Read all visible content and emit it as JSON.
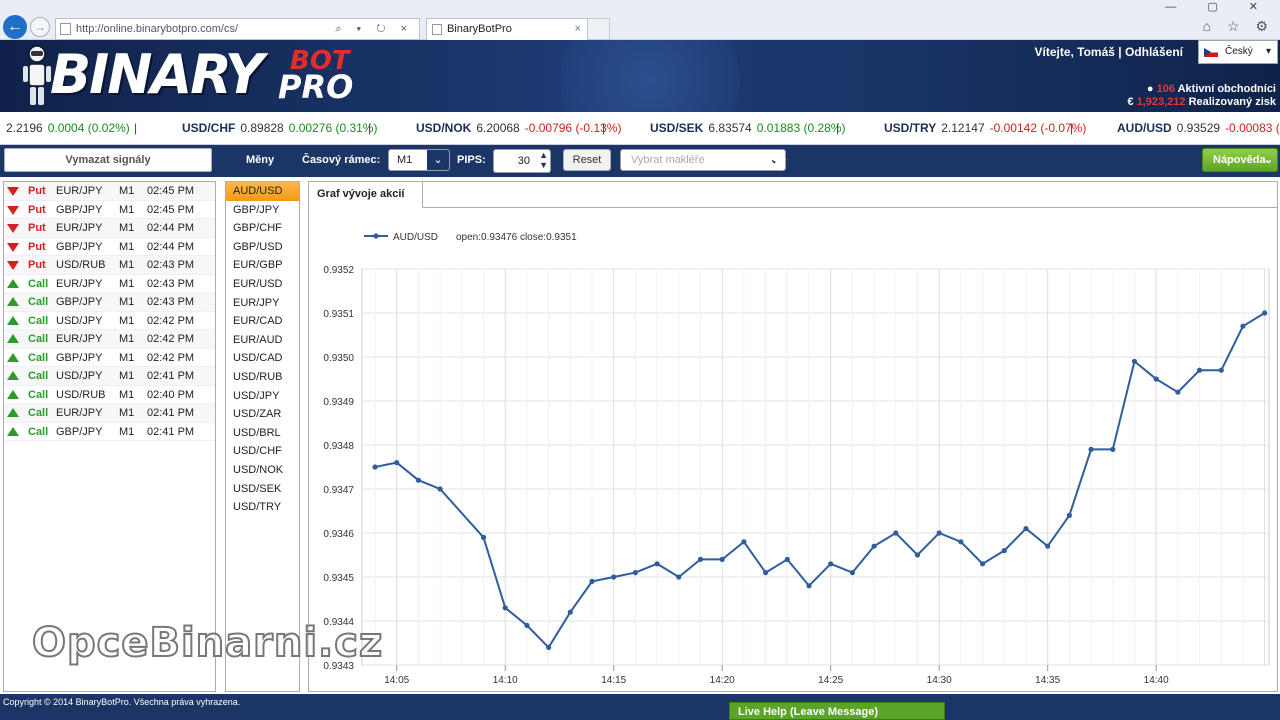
{
  "browser": {
    "url": "http://online.binarybotpro.com/cs/",
    "tab_title": "BinaryBotPro",
    "tab_close": "×",
    "address_tools": "⌕ ▾ ↻ ×",
    "win_controls": "— ▢ ✕",
    "icons": "⌂ ☆ ⚙"
  },
  "header": {
    "logo_text": "BINARY",
    "logo_bot": "BOT",
    "logo_pro": "PRO",
    "welcome": "Vítejte, Tomáš | Odhlášení",
    "language": "Český",
    "active_traders_count": "106",
    "active_traders_label": "Aktivní obchodníci",
    "realized_profit_value": "1,923,212",
    "realized_profit_label": "Realizovaný zisk",
    "currency_symbol": "€"
  },
  "ticker": [
    {
      "sym": "",
      "price": "2.2196",
      "change": "0.0004 (0.02%)",
      "dir": "up"
    },
    {
      "sym": "USD/CHF",
      "price": "0.89828",
      "change": "0.00276 (0.31%)",
      "dir": "up"
    },
    {
      "sym": "USD/NOK",
      "price": "6.20068",
      "change": "-0.00796 (-0.13%)",
      "dir": "down"
    },
    {
      "sym": "USD/SEK",
      "price": "6.83574",
      "change": "0.01883 (0.28%)",
      "dir": "up"
    },
    {
      "sym": "USD/TRY",
      "price": "2.12147",
      "change": "-0.00142 (-0.07%)",
      "dir": "down"
    },
    {
      "sym": "AUD/USD",
      "price": "0.93529",
      "change": "-0.00083 (-0.09%)",
      "dir": "down"
    }
  ],
  "toolbar": {
    "clear_label": "Vymazat signály",
    "currencies_label": "Měny",
    "timeframe_label": "Časový rámec:",
    "timeframe_value": "M1",
    "pips_label": "PIPS:",
    "pips_value": "30",
    "reset_label": "Reset",
    "broker_placeholder": "Vybrat makléře",
    "help_label": "Nápověda"
  },
  "signals": [
    {
      "type": "Put",
      "pair": "EUR/JPY",
      "tf": "M1",
      "time": "02:45 PM"
    },
    {
      "type": "Put",
      "pair": "GBP/JPY",
      "tf": "M1",
      "time": "02:45 PM"
    },
    {
      "type": "Put",
      "pair": "EUR/JPY",
      "tf": "M1",
      "time": "02:44 PM"
    },
    {
      "type": "Put",
      "pair": "GBP/JPY",
      "tf": "M1",
      "time": "02:44 PM"
    },
    {
      "type": "Put",
      "pair": "USD/RUB",
      "tf": "M1",
      "time": "02:43 PM"
    },
    {
      "type": "Call",
      "pair": "EUR/JPY",
      "tf": "M1",
      "time": "02:43 PM"
    },
    {
      "type": "Call",
      "pair": "GBP/JPY",
      "tf": "M1",
      "time": "02:43 PM"
    },
    {
      "type": "Call",
      "pair": "USD/JPY",
      "tf": "M1",
      "time": "02:42 PM"
    },
    {
      "type": "Call",
      "pair": "EUR/JPY",
      "tf": "M1",
      "time": "02:42 PM"
    },
    {
      "type": "Call",
      "pair": "GBP/JPY",
      "tf": "M1",
      "time": "02:42 PM"
    },
    {
      "type": "Call",
      "pair": "USD/JPY",
      "tf": "M1",
      "time": "02:41 PM"
    },
    {
      "type": "Call",
      "pair": "USD/RUB",
      "tf": "M1",
      "time": "02:40 PM"
    },
    {
      "type": "Call",
      "pair": "EUR/JPY",
      "tf": "M1",
      "time": "02:41 PM"
    },
    {
      "type": "Call",
      "pair": "GBP/JPY",
      "tf": "M1",
      "time": "02:41 PM"
    }
  ],
  "pairs": [
    "AUD/USD",
    "GBP/JPY",
    "GBP/CHF",
    "GBP/USD",
    "EUR/GBP",
    "EUR/USD",
    "EUR/JPY",
    "EUR/CAD",
    "EUR/AUD",
    "USD/CAD",
    "USD/RUB",
    "USD/JPY",
    "USD/ZAR",
    "USD/BRL",
    "USD/CHF",
    "USD/NOK",
    "USD/SEK",
    "USD/TRY"
  ],
  "selected_pair": "AUD/USD",
  "chart_tab": "Graf vývoje akcií",
  "chart_data": {
    "type": "line",
    "title": "",
    "xlabel": "",
    "ylabel": "",
    "legend_series": "AUD/USD",
    "legend_info": "open:0.93476 close:0.9351",
    "legend_position": "top-left",
    "grid": true,
    "x_ticks": [
      "14:05",
      "14:10",
      "14:15",
      "14:20",
      "14:25",
      "14:30",
      "14:35",
      "14:40"
    ],
    "y_ticks": [
      "0.9343",
      "0.9344",
      "0.9345",
      "0.9346",
      "0.9347",
      "0.9348",
      "0.9349",
      "0.9350",
      "0.9351",
      "0.9352"
    ],
    "ylim": [
      0.9343,
      0.9352
    ],
    "xlim_minutes": [
      14.0,
      14.73
    ],
    "series": [
      {
        "name": "AUD/USD",
        "color": "#2f5d9e",
        "points": [
          [
            "14:04",
            0.93475
          ],
          [
            "14:05",
            0.93476
          ],
          [
            "14:06",
            0.93472
          ],
          [
            "14:07",
            0.9347
          ],
          [
            "14:09",
            0.93459
          ],
          [
            "14:10",
            0.93443
          ],
          [
            "14:11",
            0.93439
          ],
          [
            "14:12",
            0.93434
          ],
          [
            "14:13",
            0.93442
          ],
          [
            "14:14",
            0.93449
          ],
          [
            "14:15",
            0.9345
          ],
          [
            "14:16",
            0.93451
          ],
          [
            "14:17",
            0.93453
          ],
          [
            "14:18",
            0.9345
          ],
          [
            "14:19",
            0.93454
          ],
          [
            "14:20",
            0.93454
          ],
          [
            "14:21",
            0.93458
          ],
          [
            "14:22",
            0.93451
          ],
          [
            "14:23",
            0.93454
          ],
          [
            "14:24",
            0.93448
          ],
          [
            "14:25",
            0.93453
          ],
          [
            "14:26",
            0.93451
          ],
          [
            "14:27",
            0.93457
          ],
          [
            "14:28",
            0.9346
          ],
          [
            "14:29",
            0.93455
          ],
          [
            "14:30",
            0.9346
          ],
          [
            "14:31",
            0.93458
          ],
          [
            "14:32",
            0.93453
          ],
          [
            "14:33",
            0.93456
          ],
          [
            "14:34",
            0.93461
          ],
          [
            "14:35",
            0.93457
          ],
          [
            "14:36",
            0.93464
          ],
          [
            "14:37",
            0.93479
          ],
          [
            "14:38",
            0.93479
          ],
          [
            "14:39",
            0.93499
          ],
          [
            "14:40",
            0.93495
          ],
          [
            "14:41",
            0.93492
          ],
          [
            "14:42",
            0.93497
          ],
          [
            "14:43",
            0.93497
          ],
          [
            "14:44",
            0.93507
          ],
          [
            "14:45",
            0.9351
          ]
        ]
      }
    ]
  },
  "watermark": "OpceBinarni.cz",
  "footer": {
    "copyright": "Copyright © 2014 BinaryBotPro. Všechna práva vyhrazena.",
    "live_help": "Live Help (Leave Message)"
  }
}
